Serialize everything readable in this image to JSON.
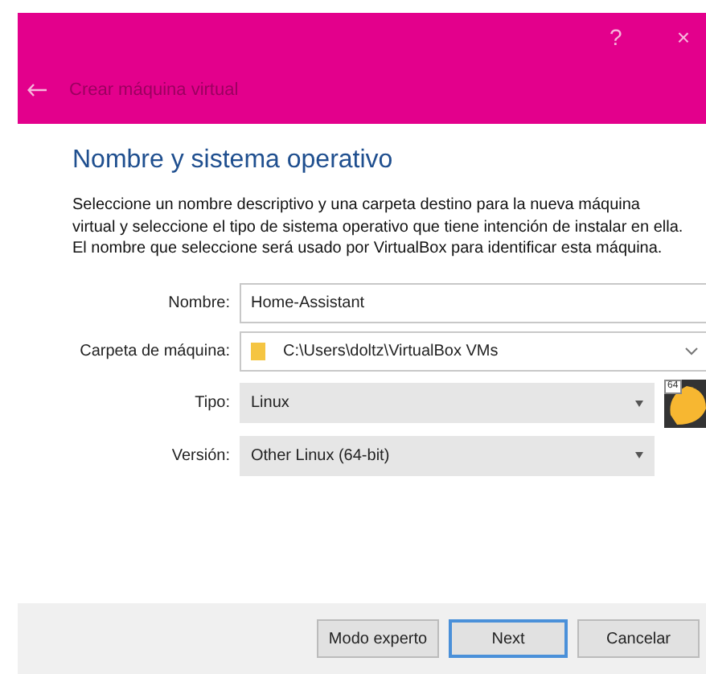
{
  "window": {
    "help": "?",
    "close": "×",
    "title": "Crear máquina virtual"
  },
  "heading": "Nombre y sistema operativo",
  "description": "Seleccione un nombre descriptivo y una carpeta destino para la nueva máquina virtual y seleccione el tipo de sistema operativo que tiene intención de instalar en ella. El nombre que seleccione será usado por VirtualBox para identificar esta máquina.",
  "fields": [
    {
      "kind": "text",
      "label": "Nombre:",
      "value": "Home-Assistant"
    },
    {
      "kind": "folder",
      "label": "Carpeta de máquina:",
      "value": "C:\\Users\\doltz\\VirtualBox VMs"
    },
    {
      "kind": "select",
      "label": "Tipo:",
      "value": "Linux"
    },
    {
      "kind": "select",
      "label": "Versión:",
      "value": "Other Linux (64-bit)"
    }
  ],
  "os_icon_badge": "64",
  "buttons": [
    {
      "label": "Modo experto",
      "default": false
    },
    {
      "label": "Next",
      "default": true
    },
    {
      "label": "Cancelar",
      "default": false
    }
  ]
}
